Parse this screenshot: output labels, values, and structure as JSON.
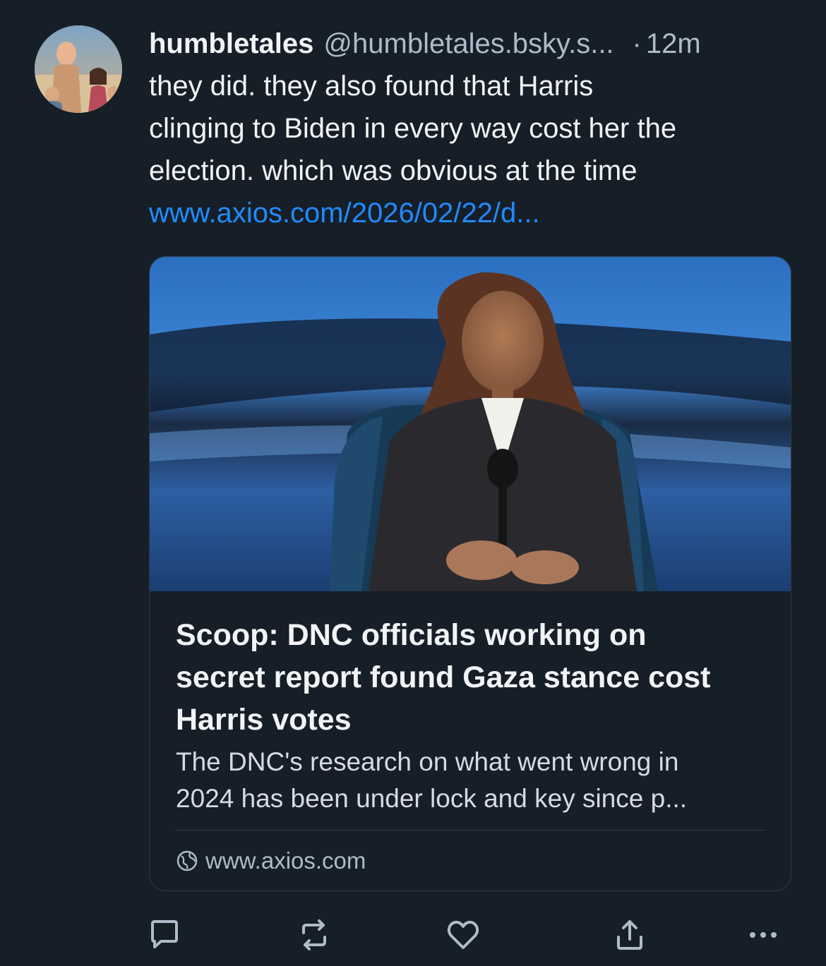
{
  "post": {
    "display_name": "humbletales",
    "handle": "@humbletales.bsky.s...",
    "separator": "·",
    "time": "12m",
    "text_lines": [
      "they did. they also found that Harris",
      "clinging to Biden in every way cost her the",
      "election. which was obvious at the time"
    ],
    "link": "www.axios.com/2026/02/22/d..."
  },
  "card": {
    "title_lines": [
      "Scoop: DNC officials working on",
      "secret report found Gaza stance cost",
      "Harris votes"
    ],
    "description_lines": [
      "The DNC's research on what went wrong in",
      "2024 has been under lock and key since p..."
    ],
    "domain": "www.axios.com",
    "domain_icon": "globe-icon"
  },
  "actions": {
    "reply_icon": "reply-icon",
    "repost_icon": "repost-icon",
    "like_icon": "heart-icon",
    "share_icon": "share-icon",
    "more_icon": "more-icon"
  },
  "colors": {
    "background": "#161e27",
    "text": "#f1f3f5",
    "muted": "#aebbc9",
    "link": "#208bfe",
    "border": "#2e3a47"
  }
}
